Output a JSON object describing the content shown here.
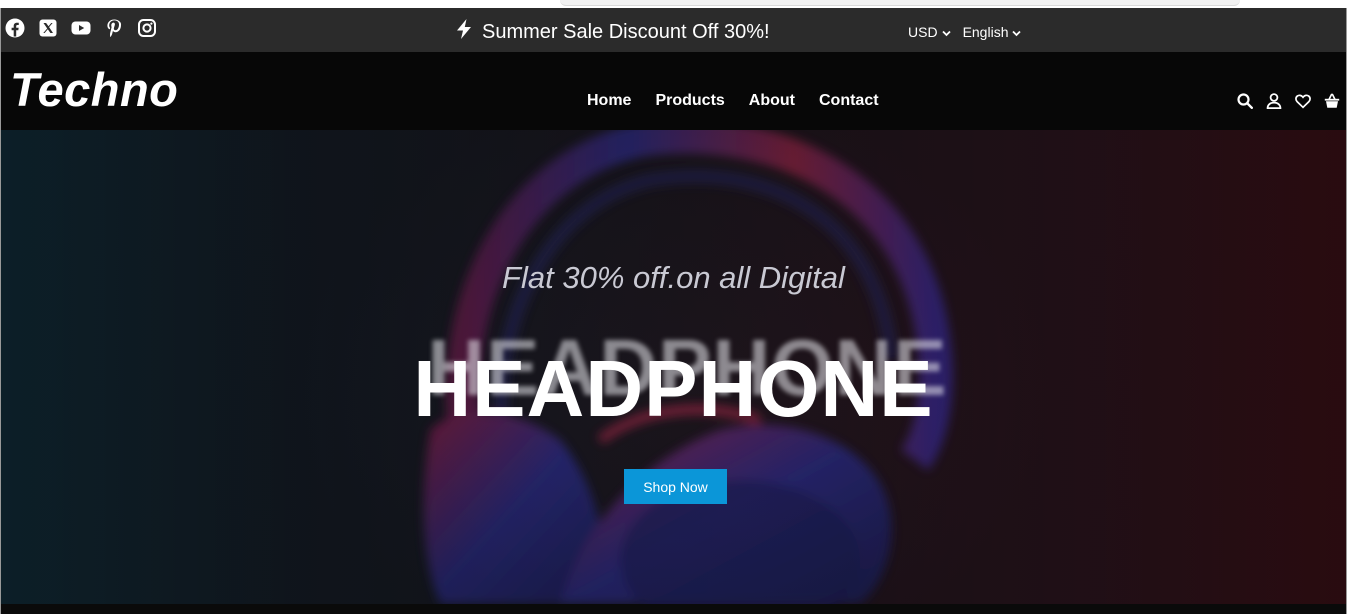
{
  "top_bar": {
    "social_icons": [
      "facebook-icon",
      "x-twitter-icon",
      "youtube-icon",
      "pinterest-icon",
      "instagram-icon"
    ],
    "promo_text": "Summer Sale Discount Off 30%!",
    "promo_icon": "lightning-bolt-icon",
    "currency": "USD",
    "language": "English"
  },
  "header": {
    "logo": "Techno",
    "nav": [
      "Home",
      "Products",
      "About",
      "Contact"
    ],
    "icons": [
      "search-icon",
      "user-icon",
      "heart-icon",
      "cart-basket-icon"
    ]
  },
  "hero": {
    "subtitle": "Flat 30% off.on all Digital",
    "title": "HEADPHONE",
    "cta": "Shop Now"
  },
  "colors": {
    "top_bar_bg": "#2b2b2b",
    "header_bg": "#070707",
    "cta_bg": "#0b96d8",
    "text": "#ffffff"
  }
}
